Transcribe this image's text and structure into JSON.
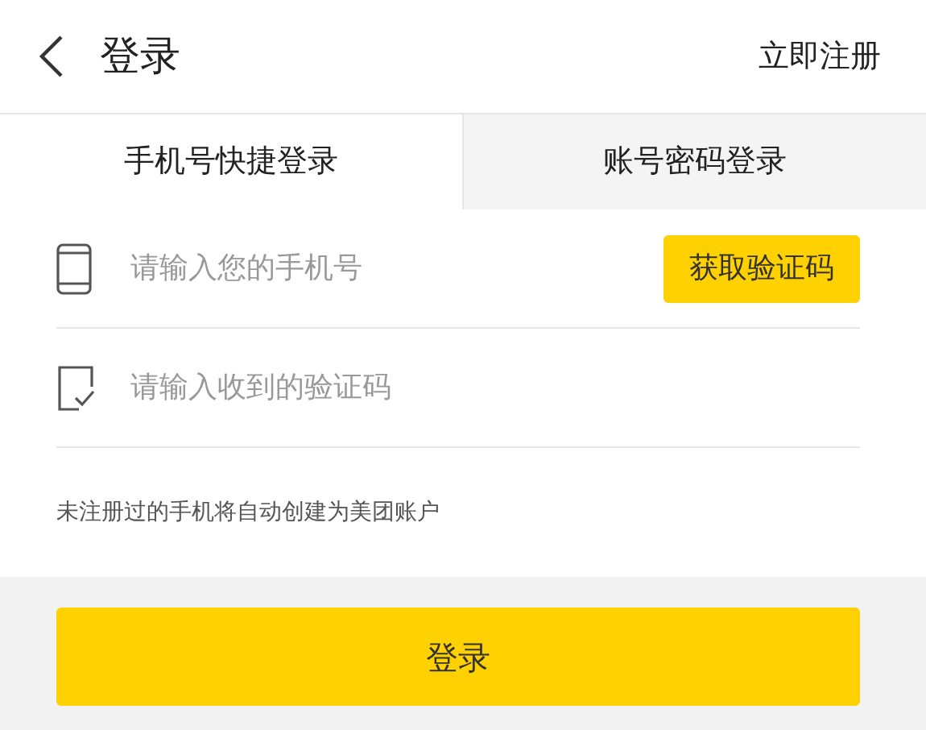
{
  "header": {
    "title": "登录",
    "action": "立即注册"
  },
  "tabs": [
    {
      "label": "手机号快捷登录",
      "selected": true
    },
    {
      "label": "账号密码登录",
      "selected": false
    }
  ],
  "fields": [
    {
      "kind": "phone",
      "placeholder": "请输入您的手机号",
      "button": "获取验证码"
    },
    {
      "kind": "code",
      "placeholder": "请输入收到的验证码"
    }
  ],
  "hint": "未注册过的手机将自动创建为美团账户",
  "submit": "登录"
}
